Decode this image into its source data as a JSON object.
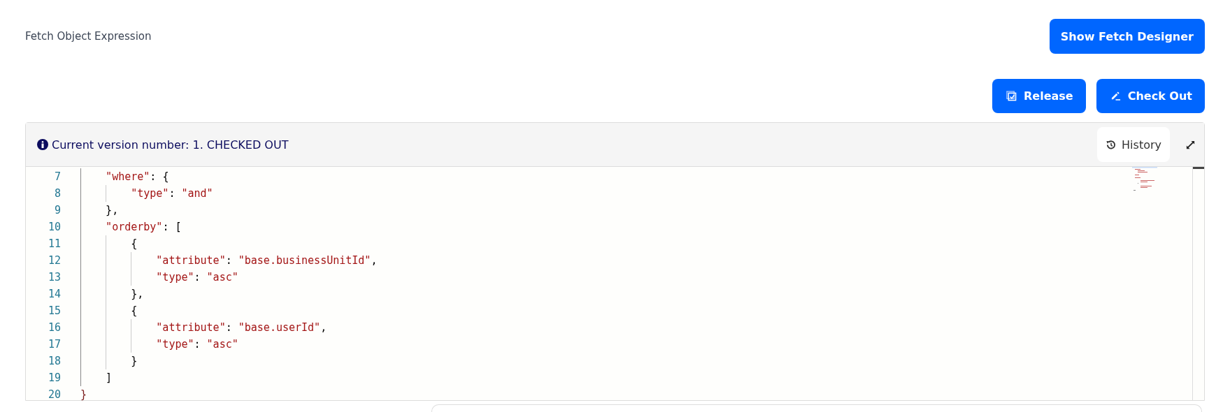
{
  "title": "Fetch Object Expression",
  "designer_button": "Show Fetch Designer",
  "actions": [
    {
      "kind": "release",
      "label": "Release"
    },
    {
      "kind": "checkout",
      "label": "Check Out"
    }
  ],
  "editor": {
    "status": "Current version number: 1. CHECKED OUT",
    "history_button": "History",
    "lines": [
      {
        "children": [
          {
            "number": "7",
            "tokens": [
              {
                "kind": "string",
                "text": "\"where\""
              },
              {
                "kind": "punct",
                "text": ": {"
              }
            ],
            "children": [
              {
                "number": "8",
                "tokens": [
                  {
                    "kind": "string",
                    "text": "\"type\""
                  },
                  {
                    "kind": "punct",
                    "text": ": "
                  },
                  {
                    "kind": "string",
                    "text": "\"and\""
                  }
                ]
              }
            ]
          },
          {
            "number": "9",
            "tokens": [
              {
                "kind": "punct",
                "text": "},"
              }
            ]
          },
          {
            "number": "10",
            "tokens": [
              {
                "kind": "string",
                "text": "\"orderby\""
              },
              {
                "kind": "punct",
                "text": ": ["
              }
            ],
            "children": [
              {
                "number": "11",
                "tokens": [
                  {
                    "kind": "punct",
                    "text": "{"
                  }
                ],
                "children": [
                  {
                    "number": "12",
                    "tokens": [
                      {
                        "kind": "string",
                        "text": "\"attribute\""
                      },
                      {
                        "kind": "punct",
                        "text": ": "
                      },
                      {
                        "kind": "string",
                        "text": "\"base.businessUnitId\""
                      },
                      {
                        "kind": "punct",
                        "text": ","
                      }
                    ]
                  },
                  {
                    "number": "13",
                    "tokens": [
                      {
                        "kind": "string",
                        "text": "\"type\""
                      },
                      {
                        "kind": "punct",
                        "text": ": "
                      },
                      {
                        "kind": "string",
                        "text": "\"asc\""
                      }
                    ]
                  }
                ]
              },
              {
                "number": "14",
                "tokens": [
                  {
                    "kind": "punct",
                    "text": "},"
                  }
                ]
              },
              {
                "number": "15",
                "tokens": [
                  {
                    "kind": "punct",
                    "text": "{"
                  }
                ],
                "children": [
                  {
                    "number": "16",
                    "tokens": [
                      {
                        "kind": "string",
                        "text": "\"attribute\""
                      },
                      {
                        "kind": "punct",
                        "text": ": "
                      },
                      {
                        "kind": "string",
                        "text": "\"base.userId\""
                      },
                      {
                        "kind": "punct",
                        "text": ","
                      }
                    ]
                  },
                  {
                    "number": "17",
                    "tokens": [
                      {
                        "kind": "string",
                        "text": "\"type\""
                      },
                      {
                        "kind": "punct",
                        "text": ": "
                      },
                      {
                        "kind": "string",
                        "text": "\"asc\""
                      }
                    ]
                  }
                ]
              },
              {
                "number": "18",
                "tokens": [
                  {
                    "kind": "punct",
                    "text": "}"
                  }
                ]
              }
            ]
          },
          {
            "number": "19",
            "tokens": [
              {
                "kind": "punct",
                "text": "]"
              }
            ]
          }
        ]
      },
      {
        "number": "20",
        "tokens": [
          {
            "kind": "brace",
            "text": "}"
          }
        ]
      }
    ]
  }
}
